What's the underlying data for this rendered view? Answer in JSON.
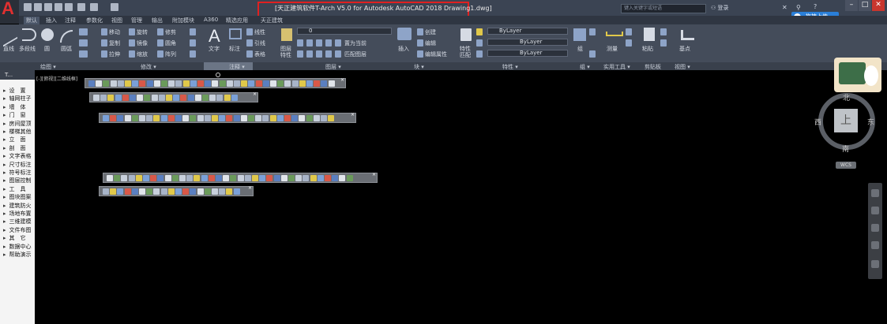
{
  "titlebar": {
    "window_title": "[天正建筑软件T-Arch V5.0 for Autodesk AutoCAD 2018    Drawing1.dwg]",
    "search_placeholder": "键入关键字或短语",
    "login_label": "登录",
    "share_label": "拖拽上传"
  },
  "tabs": [
    "默认",
    "插入",
    "注释",
    "参数化",
    "视图",
    "管理",
    "输出",
    "附加模块",
    "A360",
    "精选应用",
    "天正建筑"
  ],
  "active_tab": "默认",
  "ribbon": {
    "draw": {
      "line": "直线",
      "polyline": "多段线",
      "circle": "圆",
      "arc": "圆弧"
    },
    "modify": {
      "move": "移动",
      "rotate": "旋转",
      "trim": "修剪",
      "copy": "复制",
      "mirror": "镜像",
      "fillet": "圆角",
      "stretch": "拉伸",
      "scale": "缩放",
      "array": "阵列"
    },
    "annotation": {
      "text": "文字",
      "dimension": "标注",
      "linear": "线性",
      "leader": "引线",
      "table": "表格"
    },
    "layers": {
      "layer_props": "图层特性",
      "layer_value": "0",
      "make_current": "置为当前",
      "match_layer": "匹配图层"
    },
    "block": {
      "insert": "插入",
      "create": "创建",
      "edit": "编辑",
      "edit_attr": "编辑属性"
    },
    "properties": {
      "match": "特性匹配",
      "color": "ByLayer",
      "linetype": "ByLayer",
      "lineweight": "ByLayer"
    },
    "groups": {
      "group": "组"
    },
    "utilities": {
      "measure": "测量"
    },
    "clipboard": {
      "paste": "粘贴"
    },
    "view": {
      "base": "基点"
    },
    "panel_titles": {
      "draw": "绘图 ▾",
      "modify": "修改 ▾",
      "annotation": "注释 ▾",
      "layers": "图层 ▾",
      "block": "块 ▾",
      "properties": "特性 ▾",
      "groups": "组 ▾",
      "utilities": "实用工具 ▾",
      "clipboard": "剪贴板",
      "view": "视图 ▾"
    }
  },
  "palette": {
    "header": "T...",
    "items": [
      "设　置",
      "轴网柱子",
      "墙　体",
      "门　窗",
      "房间屋顶",
      "楼梯其他",
      "立　面",
      "剖　面",
      "文字表格",
      "尺寸标注",
      "符号标注",
      "图层控制",
      "工　具",
      "图块图案",
      "建筑防火",
      "场地布置",
      "三维建模",
      "文件布图",
      "其　它",
      "数据中心",
      "帮助演示"
    ]
  },
  "viewport": {
    "label": "[-][俯视][二维线框]"
  },
  "navigation": {
    "north": "北",
    "south": "南",
    "east": "东",
    "west": "西",
    "top_face": "上",
    "wcs": "WCS"
  },
  "colors": {
    "title_highlight": "#e02020",
    "accent": "#2a7fd8",
    "background": "#000000"
  }
}
